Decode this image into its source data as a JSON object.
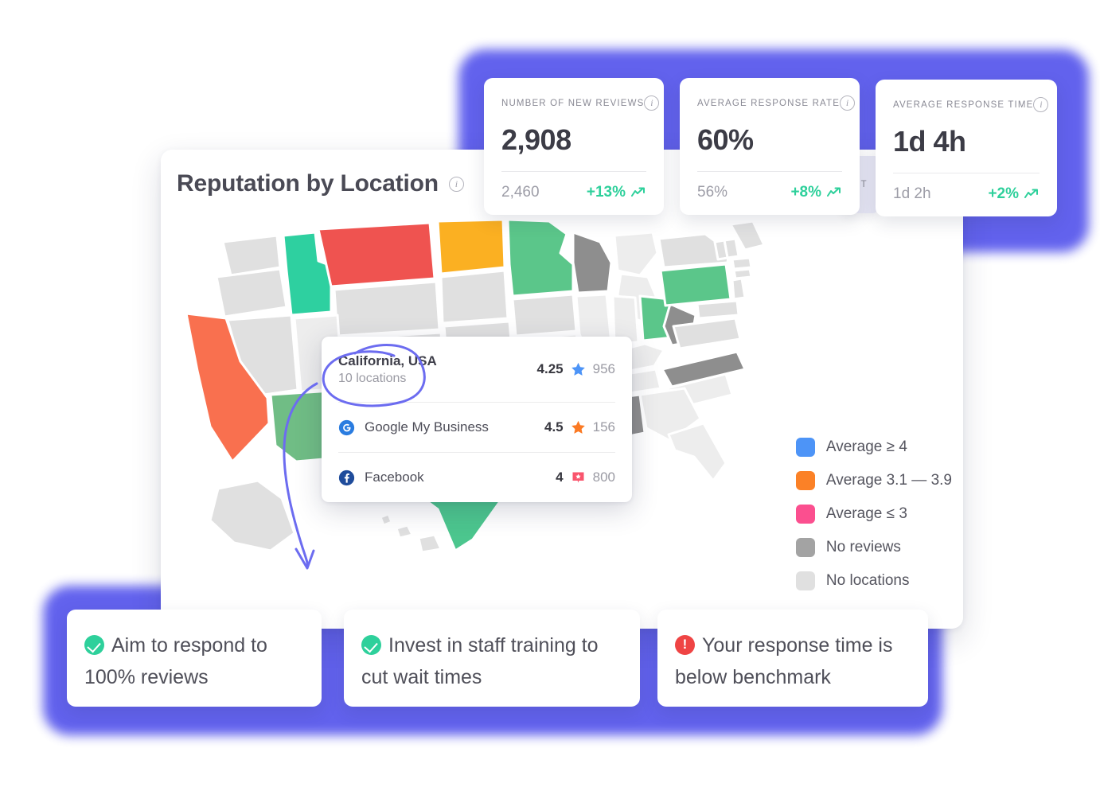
{
  "card": {
    "title": "Reputation by Location",
    "info_icon": "info-icon"
  },
  "kpis": [
    {
      "label": "NUMBER OF NEW REVIEWS",
      "value": "2,908",
      "previous": "2,460",
      "delta": "+13%",
      "trend_icon": "trend-up-icon",
      "info_icon": "info-icon"
    },
    {
      "label": "AVERAGE RESPONSE RATE",
      "value": "60%",
      "previous": "56%",
      "delta": "+8%",
      "trend_icon": "trend-up-icon",
      "info_icon": "info-icon"
    },
    {
      "label": "AVERAGE RESPONSE TIME",
      "value": "1d 4h",
      "previous": "1d 2h",
      "delta": "+2%",
      "trend_icon": "trend-up-icon",
      "info_icon": "info-icon"
    }
  ],
  "hidden_kpi_fragment": "NT",
  "tooltip": {
    "location_name": "California, USA",
    "location_sub": "10 locations",
    "overall_score": "4.25",
    "overall_count": "956",
    "overall_star_color": "#4d94f7",
    "sources": [
      {
        "icon": "google-my-business-icon",
        "name": "Google My Business",
        "score": "4.5",
        "count": "156",
        "star_color": "#fb7a24"
      },
      {
        "icon": "facebook-icon",
        "name": "Facebook",
        "score": "4",
        "count": "800",
        "star_color": "#f9556d"
      }
    ]
  },
  "legend": {
    "items": [
      {
        "label": "Average ≥ 4",
        "color": "#4d94f7"
      },
      {
        "label": "Average 3.1 — 3.9",
        "color": "#fb8127"
      },
      {
        "label": "Average ≤ 3",
        "color": "#fb4f8f"
      },
      {
        "label": "No reviews",
        "color": "#a3a3a3"
      },
      {
        "label": "No locations",
        "color": "#e0e0e0"
      }
    ]
  },
  "recommendations": [
    {
      "badge": "check-icon",
      "badge_type": "ok",
      "text": "Aim to respond to 100% reviews"
    },
    {
      "badge": "check-icon",
      "badge_type": "ok",
      "text": "Invest in staff training to cut wait times"
    },
    {
      "badge": "alert-icon",
      "badge_type": "warn",
      "text": "Your response time is below benchmark"
    }
  ],
  "chart_data": {
    "type": "map",
    "title": "Reputation by Location",
    "region": "United States",
    "color_scale": [
      {
        "label": "Average ≥ 4",
        "color": "#4d94f7"
      },
      {
        "label": "Average 3.1 — 3.9",
        "color": "#fb8127"
      },
      {
        "label": "Average ≤ 3",
        "color": "#fb4f8f"
      },
      {
        "label": "No reviews",
        "color": "#a3a3a3"
      },
      {
        "label": "No locations",
        "color": "#e0e0e0"
      }
    ],
    "highlighted_region": {
      "name": "California, USA",
      "locations": 10,
      "average": 4.25,
      "reviews": 956,
      "breakdown": [
        {
          "source": "Google My Business",
          "average": 4.5,
          "reviews": 156
        },
        {
          "source": "Facebook",
          "average": 4,
          "reviews": 800
        }
      ]
    },
    "states": [
      {
        "state": "California",
        "bucket": "Average 3.1 — 3.9",
        "color": "#f9704f"
      },
      {
        "state": "Montana",
        "bucket": "Average ≤ 3",
        "color": "#ef5350"
      },
      {
        "state": "Idaho",
        "bucket": "Average ≥ 4",
        "color": "#2ed0a0"
      },
      {
        "state": "North Dakota",
        "bucket": "Average 3.1 — 3.9",
        "color": "#fbb022"
      },
      {
        "state": "Minnesota",
        "bucket": "Average ≥ 4",
        "color": "#5bc68a"
      },
      {
        "state": "Wisconsin",
        "bucket": "No reviews",
        "color": "#8e8e8e"
      },
      {
        "state": "Arizona",
        "bucket": "Average ≥ 4",
        "color": "#70bd85"
      },
      {
        "state": "New Mexico",
        "bucket": "Average 3.1 — 3.9",
        "color": "#c49c28"
      },
      {
        "state": "Texas",
        "bucket": "Average ≥ 4",
        "color": "#4cc68e"
      },
      {
        "state": "Mississippi",
        "bucket": "Average ≥ 4",
        "color": "#4cc68e"
      },
      {
        "state": "Alabama",
        "bucket": "No reviews",
        "color": "#8e8e8e"
      },
      {
        "state": "Pennsylvania",
        "bucket": "Average ≥ 4",
        "color": "#5bc68a"
      },
      {
        "state": "Ohio",
        "bucket": "Average ≥ 4",
        "color": "#5bc68a"
      },
      {
        "state": "West Virginia",
        "bucket": "No reviews",
        "color": "#8e8e8e"
      },
      {
        "state": "North Carolina",
        "bucket": "No reviews",
        "color": "#8e8e8e"
      },
      {
        "state": "Other states",
        "bucket": "No locations",
        "color": "#e0e0e0"
      }
    ]
  },
  "annotation": {
    "type": "hand-drawn-circle-and-arrow",
    "target": "California, USA tooltip header",
    "color": "#6c6cf0"
  }
}
